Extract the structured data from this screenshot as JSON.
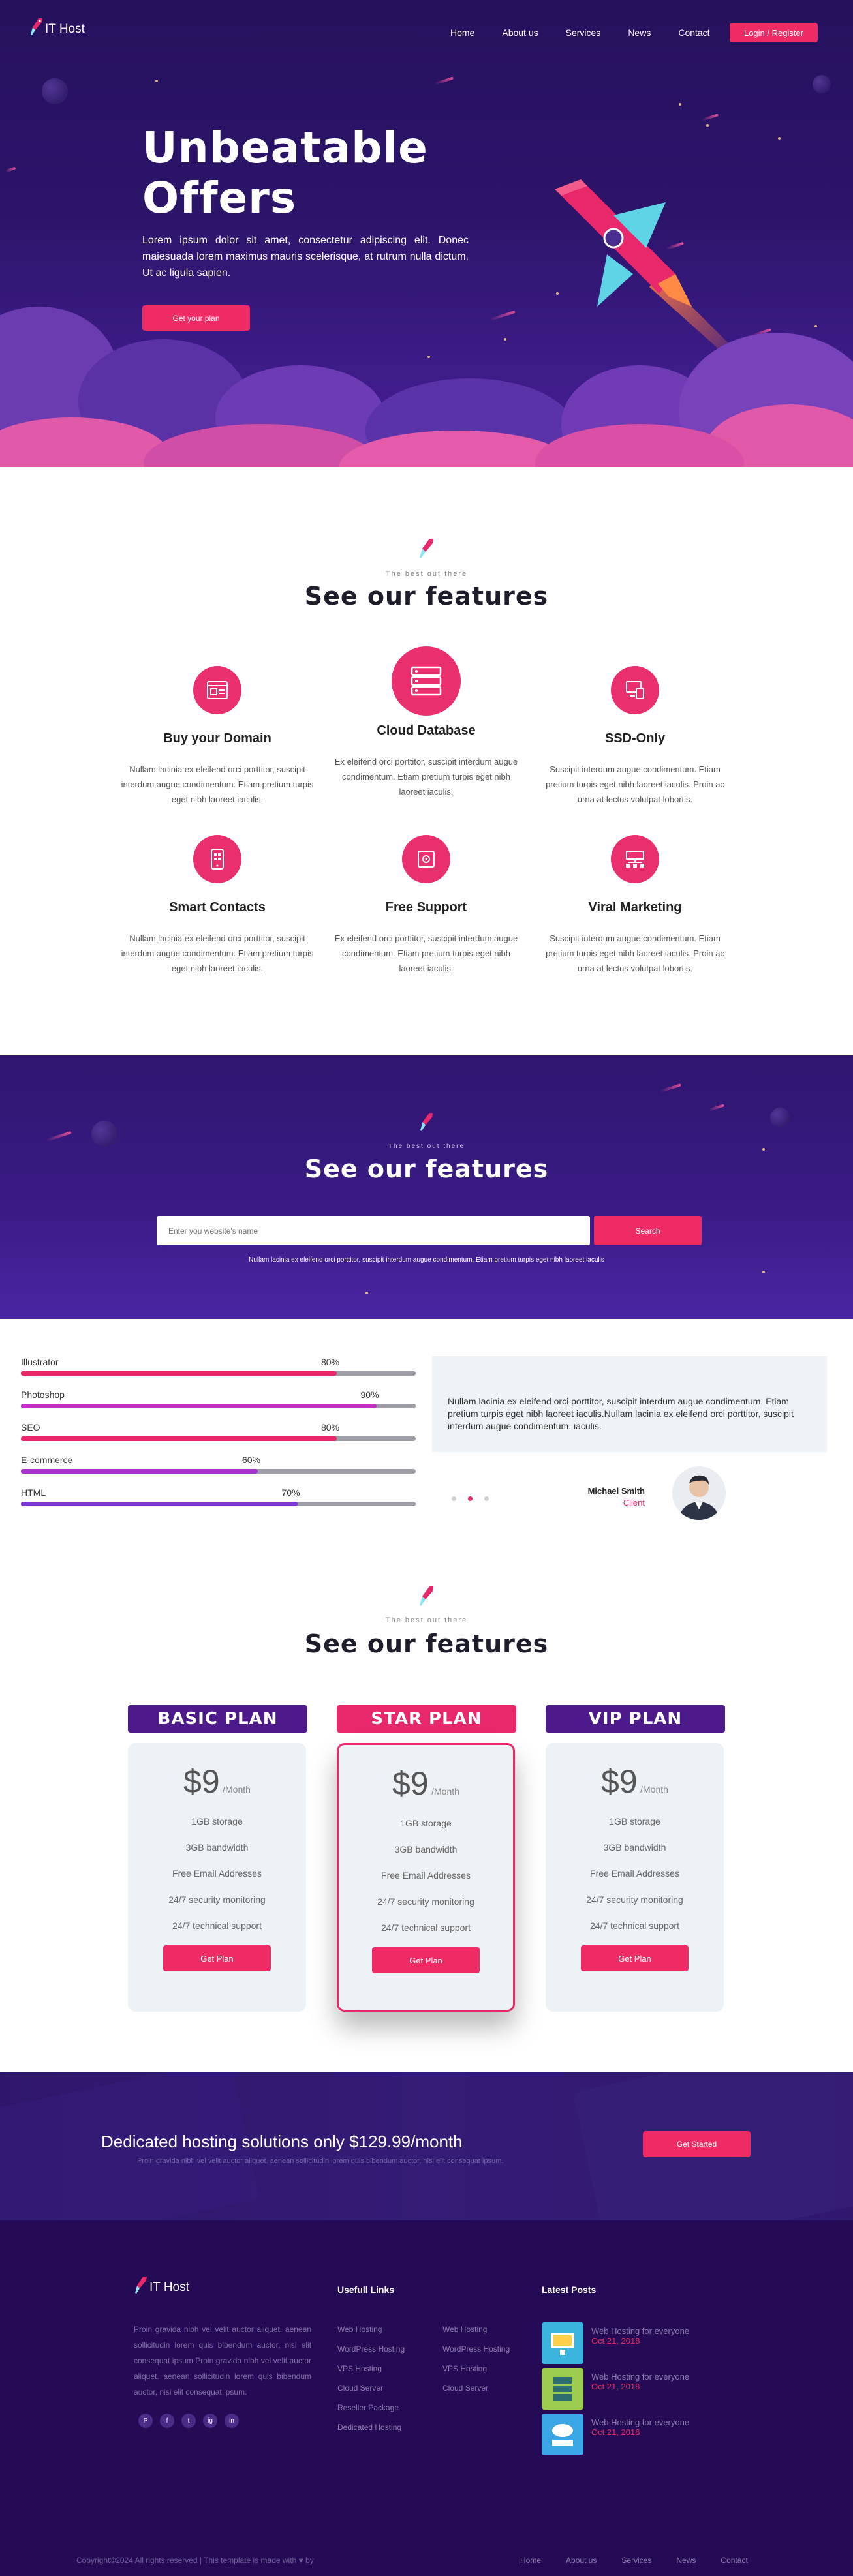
{
  "header": {
    "logo_text": "IT Host",
    "nav": [
      "Home",
      "About us",
      "Services",
      "News",
      "Contact"
    ],
    "login_label": "Login / Register"
  },
  "hero": {
    "title_line1": "Unbeatable",
    "title_line2": "Offers",
    "text": "Lorem ipsum dolor sit amet, consectetur adipiscing elit. Donec maiesuada lorem maximus mauris scelerisque, at rutrum nulla dictum. Ut ac ligula sapien.",
    "cta_label": "Get your plan"
  },
  "features": {
    "eyebrow": "The best out there",
    "title": "See our features",
    "items": [
      {
        "title": "Buy your Domain",
        "icon": "browser-icon",
        "text": "Nullam lacinia ex eleifend orci porttitor, suscipit interdum augue condimentum. Etiam pretium turpis eget nibh laoreet iaculis."
      },
      {
        "title": "Cloud Database",
        "icon": "server-icon",
        "text": "Ex eleifend orci porttitor, suscipit interdum augue condimentum. Etiam pretium turpis eget nibh laoreet iaculis."
      },
      {
        "title": "SSD-Only",
        "icon": "devices-icon",
        "text": "Suscipit interdum augue condimentum. Etiam pretium turpis eget nibh laoreet iaculis. Proin ac urna at lectus volutpat lobortis."
      },
      {
        "title": "Smart Contacts",
        "icon": "phone-icon",
        "text": "Nullam lacinia ex eleifend orci porttitor, suscipit interdum augue condimentum. Etiam pretium turpis eget nibh laoreet iaculis."
      },
      {
        "title": "Free Support",
        "icon": "support-icon",
        "text": "Ex eleifend orci porttitor, suscipit interdum augue condimentum. Etiam pretium turpis eget nibh laoreet iaculis."
      },
      {
        "title": "Viral Marketing",
        "icon": "network-icon",
        "text": "Suscipit interdum augue condimentum. Etiam pretium turpis eget nibh laoreet iaculis. Proin ac urna at lectus volutpat lobortis."
      }
    ]
  },
  "search": {
    "eyebrow": "The best out there",
    "title": "See our features",
    "placeholder": "Enter you website's name",
    "button_label": "Search",
    "note": "Nullam lacinia ex eleifend orci porttitor, suscipit interdum augue condimentum. Etiam pretium turpis eget nibh laoreet iaculis"
  },
  "skills": [
    {
      "label": "Illustrator",
      "pct_text": "80%",
      "value": 0.8,
      "color": "#e8286b"
    },
    {
      "label": "Photoshop",
      "pct_text": "90%",
      "value": 0.9,
      "color": "#c82ec4"
    },
    {
      "label": "SEO",
      "pct_text": "80%",
      "value": 0.8,
      "color": "#e8286b"
    },
    {
      "label": "E-commerce",
      "pct_text": "60%",
      "value": 0.6,
      "color": "#a634c9"
    },
    {
      "label": "HTML",
      "pct_text": "70%",
      "value": 0.7,
      "color": "#7b35d0"
    }
  ],
  "testimonial": {
    "text": "Nullam lacinia ex eleifend orci porttitor, suscipit interdum augue condimentum. Etiam pretium turpis eget nibh laoreet iaculis.Nullam lacinia ex eleifend orci porttitor, suscipit interdum augue condimentum. iaculis.",
    "name": "Michael Smith",
    "role": "Client",
    "dots": 3,
    "active_dot": 2
  },
  "pricing": {
    "eyebrow": "The best out there",
    "title": "See our features",
    "plans": [
      {
        "name": "BASIC PLAN",
        "price": "$9",
        "period": "/Month",
        "features": [
          "1GB storage",
          "3GB bandwidth",
          "Free Email Addresses",
          "24/7 security monitoring",
          "24/7 technical support"
        ],
        "button": "Get Plan",
        "head_color": "#4c1a8a",
        "featured": false
      },
      {
        "name": "STAR PLAN",
        "price": "$9",
        "period": "/Month",
        "features": [
          "1GB storage",
          "3GB bandwidth",
          "Free Email Addresses",
          "24/7 security monitoring",
          "24/7 technical support"
        ],
        "button": "Get Plan",
        "head_color": "#e8286b",
        "featured": true
      },
      {
        "name": "VIP PLAN",
        "price": "$9",
        "period": "/Month",
        "features": [
          "1GB storage",
          "3GB bandwidth",
          "Free Email Addresses",
          "24/7 security monitoring",
          "24/7 technical support"
        ],
        "button": "Get Plan",
        "head_color": "#4c1a8a",
        "featured": false
      }
    ]
  },
  "promo": {
    "title": "Dedicated hosting solutions only $129.99/month",
    "sub": "Proin gravida nibh vel velit auctor aliquet. aenean sollicitudin lorem quis bibendum auctor, nisi elit consequat ipsum.",
    "button": "Get Started"
  },
  "footer": {
    "logo_text": "IT Host",
    "about": "Proin gravida nibh vel velit auctor aliquet. aenean sollicitudin lorem quis bibendum auctor, nisi elit consequat ipsum.Proin gravida nibh vel velit auctor aliquet. aenean sollicitudin lorem quis bibendum auctor, nisi elit consequat ipsum.",
    "social": [
      "P",
      "f",
      "t",
      "ig",
      "in"
    ],
    "links_title": "Usefull Links",
    "links_col1": [
      "Web Hosting",
      "WordPress Hosting",
      "VPS Hosting",
      "Cloud Server",
      "Reseller Package",
      "Dedicated Hosting"
    ],
    "links_col2": [
      "Web Hosting",
      "WordPress Hosting",
      "VPS Hosting",
      "Cloud Server"
    ],
    "posts_title": "Latest Posts",
    "posts": [
      {
        "title": "Web Hosting for everyone",
        "date": "Oct 21, 2018"
      },
      {
        "title": "Web Hosting for everyone",
        "date": "Oct 21, 2018"
      },
      {
        "title": "Web Hosting for everyone",
        "date": "Oct 21, 2018"
      }
    ],
    "copyright": "Copyright©2024 All rights reserved | This template is made with ♥ by",
    "bottom_nav": [
      "Home",
      "About us",
      "Services",
      "News",
      "Contact"
    ]
  },
  "colors": {
    "accent": "#ee2b64",
    "primary_dark": "#26115e",
    "footer_bg": "#250b55"
  }
}
